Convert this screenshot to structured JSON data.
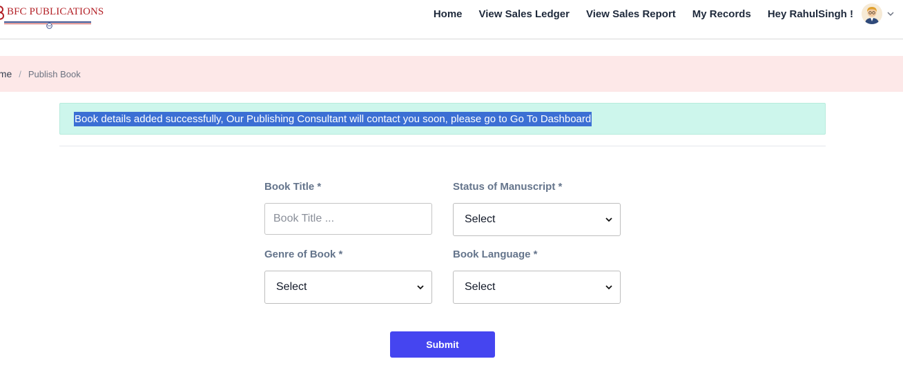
{
  "brand": {
    "name": "BFC PUBLICATIONS",
    "color": "#b32026"
  },
  "nav": {
    "items": [
      {
        "label": "Home"
      },
      {
        "label": "View Sales Ledger"
      },
      {
        "label": "View Sales Report"
      },
      {
        "label": "My Records"
      }
    ],
    "user_greeting": "Hey RahulSingh !",
    "avatar_icon": "user-avatar",
    "dropdown_icon": "chevron-down-icon"
  },
  "breadcrumb": {
    "home": "ome",
    "separator": "/",
    "current": "Publish Book"
  },
  "alert": {
    "message": "Book details added successfully, Our Publishing Consultant will contact you soon, please go to Go To Dashboard",
    "background": "#cdf6ec"
  },
  "form": {
    "book_title": {
      "label": "Book Title *",
      "placeholder": "Book Title ...",
      "value": ""
    },
    "status_of_manuscript": {
      "label": "Status of Manuscript *",
      "selected": "Select"
    },
    "genre_of_book": {
      "label": "Genre of Book *",
      "selected": "Select"
    },
    "book_language": {
      "label": "Book Language *",
      "selected": "Select"
    },
    "submit_label": "Submit",
    "submit_color": "#4545f0"
  },
  "colors": {
    "breadcrumb_bg": "#fde8e8",
    "accent": "#4545f0"
  }
}
